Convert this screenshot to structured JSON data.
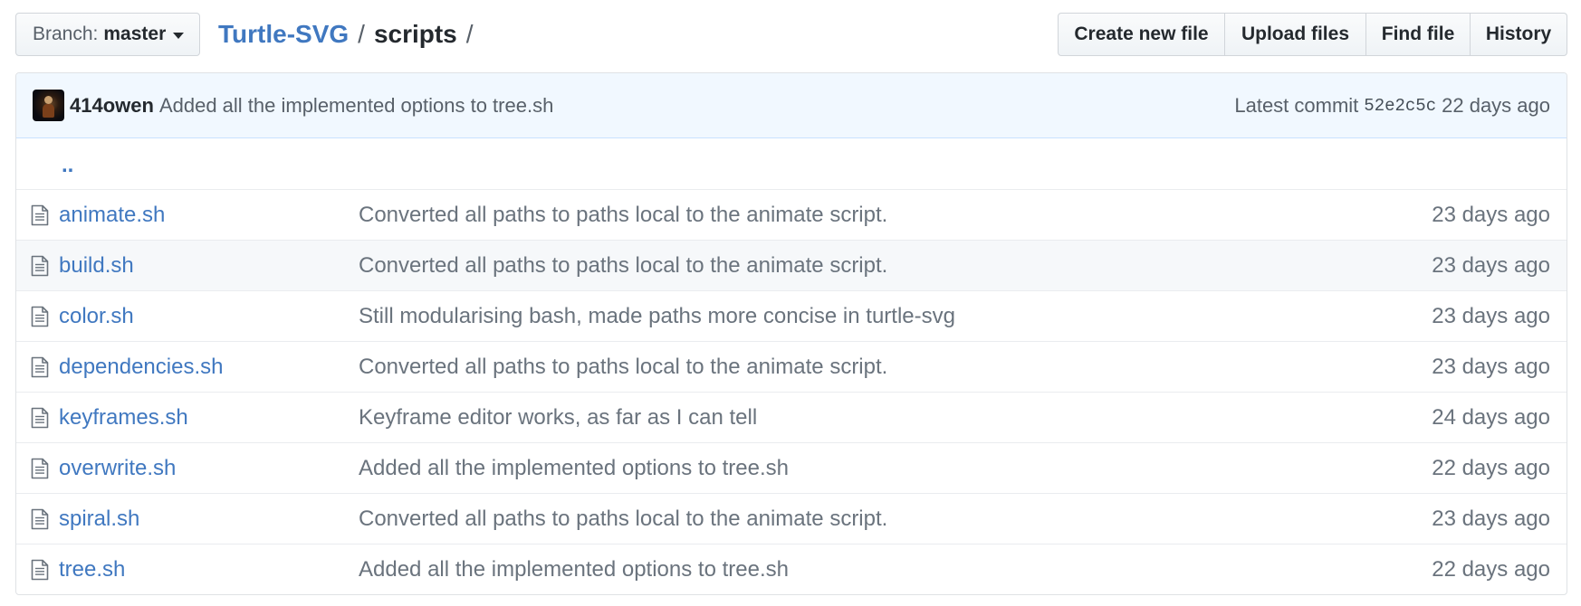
{
  "branch": {
    "prefix": "Branch:",
    "name": "master"
  },
  "breadcrumb": {
    "repo": "Turtle-SVG",
    "separator": "/",
    "dir": "scripts",
    "trailing": "/"
  },
  "actions": {
    "create": "Create new file",
    "upload": "Upload files",
    "find": "Find file",
    "history": "History"
  },
  "commit": {
    "author": "414owen",
    "message": "Added all the implemented options to tree.sh",
    "latest_label": "Latest commit",
    "sha": "52e2c5c",
    "age": "22 days ago"
  },
  "parent_link": "..",
  "files": [
    {
      "name": "animate.sh",
      "message": "Converted all paths to paths local to the animate script.",
      "age": "23 days ago"
    },
    {
      "name": "build.sh",
      "message": "Converted all paths to paths local to the animate script.",
      "age": "23 days ago"
    },
    {
      "name": "color.sh",
      "message": "Still modularising bash, made paths more concise in turtle-svg",
      "age": "23 days ago"
    },
    {
      "name": "dependencies.sh",
      "message": "Converted all paths to paths local to the animate script.",
      "age": "23 days ago"
    },
    {
      "name": "keyframes.sh",
      "message": "Keyframe editor works, as far as I can tell",
      "age": "24 days ago"
    },
    {
      "name": "overwrite.sh",
      "message": "Added all the implemented options to tree.sh",
      "age": "22 days ago"
    },
    {
      "name": "spiral.sh",
      "message": "Converted all paths to paths local to the animate script.",
      "age": "23 days ago"
    },
    {
      "name": "tree.sh",
      "message": "Added all the implemented options to tree.sh",
      "age": "22 days ago"
    }
  ],
  "icons": {
    "branch_caret": "caret-down-icon",
    "file": "file-icon"
  },
  "colors": {
    "link": "#4078c0",
    "commit_bg": "#f1f8ff",
    "muted_text": "#6a737d"
  }
}
